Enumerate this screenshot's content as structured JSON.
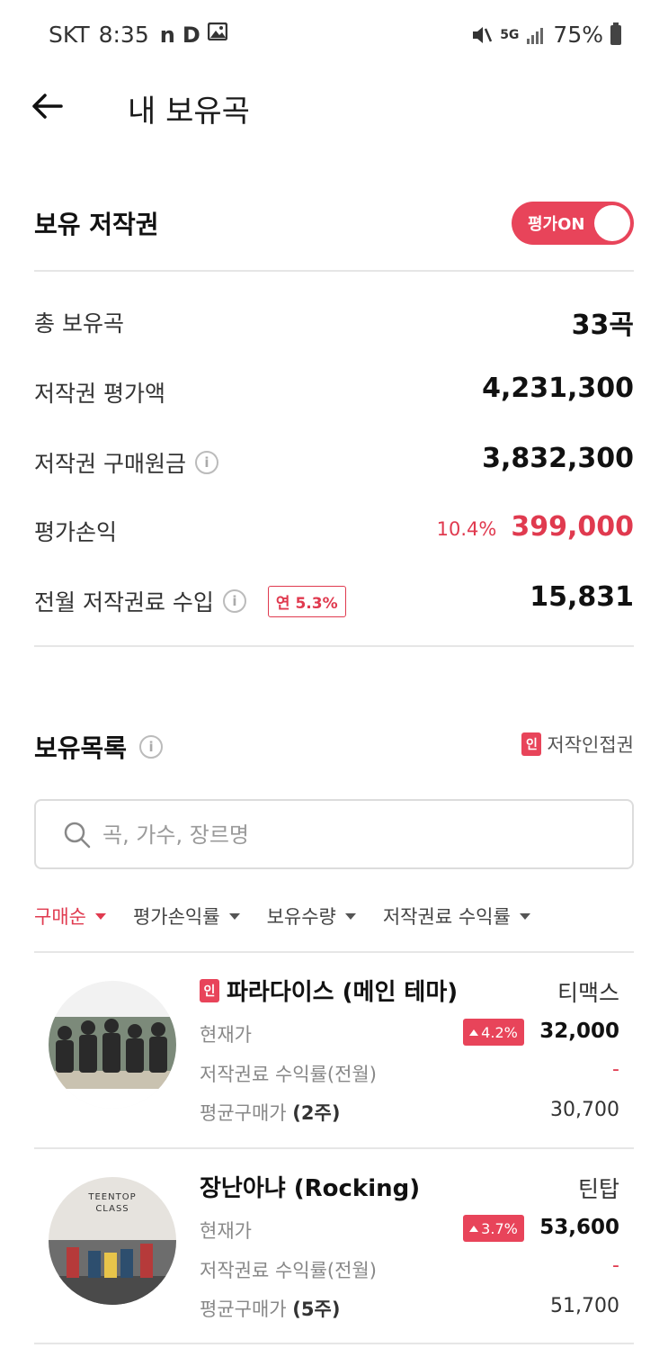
{
  "status_bar": {
    "carrier": "SKT",
    "time": "8:35",
    "notif_icons": [
      "n",
      "D"
    ],
    "network": "5G",
    "battery": "75%"
  },
  "header": {
    "title": "내 보유곡"
  },
  "copyright_section": {
    "title": "보유 저작권",
    "toggle_label": "평가ON",
    "toggle_on": true,
    "rows": [
      {
        "label": "총 보유곡",
        "value": "33곡"
      },
      {
        "label": "저작권 평가액",
        "value": "4,231,300"
      },
      {
        "label": "저작권 구매원금",
        "value": "3,832,300"
      },
      {
        "label": "평가손익",
        "pct": "10.4%",
        "value": "399,000"
      },
      {
        "label": "전월 저작권료 수입",
        "badge": "연 5.3%",
        "value": "15,831"
      }
    ]
  },
  "holdings": {
    "title": "보유목록",
    "legend_mark": "인",
    "legend_label": "저작인접권",
    "search_placeholder": "곡, 가수, 장르명",
    "sort_options": [
      "구매순",
      "평가손익률",
      "보유수량",
      "저작권료 수익률"
    ],
    "songs": [
      {
        "mark": "인",
        "title": "파라다이스 (메인 테마)",
        "artist": "티맥스",
        "current_price_label": "현재가",
        "change": "4.2%",
        "current_price": "32,000",
        "royalty_label": "저작권료 수익률(전월)",
        "royalty_value": "-",
        "avg_label": "평균구매가",
        "avg_qty": "(2주)",
        "avg_value": "30,700"
      },
      {
        "mark": "",
        "title": "장난아냐 (Rocking)",
        "artist": "틴탑",
        "art_text": "TEENTOP CLASS",
        "current_price_label": "현재가",
        "change": "3.7%",
        "current_price": "53,600",
        "royalty_label": "저작권료 수익률(전월)",
        "royalty_value": "-",
        "avg_label": "평균구매가",
        "avg_qty": "(5주)",
        "avg_value": "51,700"
      }
    ]
  },
  "colors": {
    "accent": "#e8445a",
    "loss_profit_red": "#e03a4f"
  }
}
